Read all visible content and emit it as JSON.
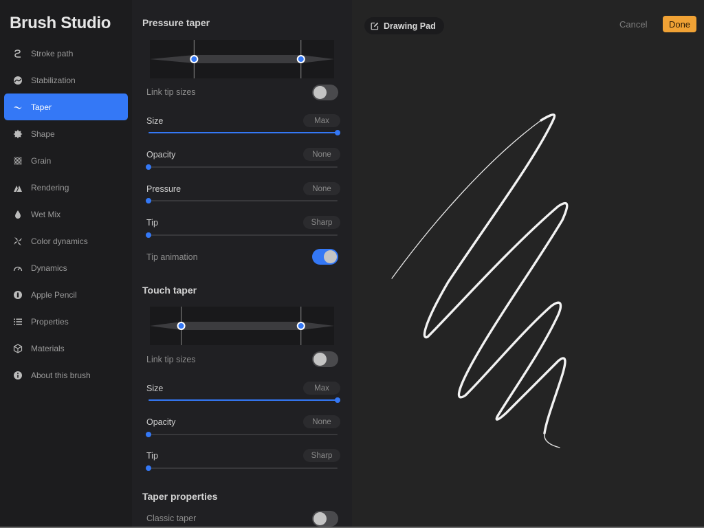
{
  "app": {
    "title": "Brush Studio"
  },
  "sidebar": {
    "items": [
      {
        "label": "Stroke path",
        "icon": "stroke-path-icon",
        "active": false
      },
      {
        "label": "Stabilization",
        "icon": "stabilization-icon",
        "active": false
      },
      {
        "label": "Taper",
        "icon": "taper-icon",
        "active": true
      },
      {
        "label": "Shape",
        "icon": "shape-icon",
        "active": false
      },
      {
        "label": "Grain",
        "icon": "grain-icon",
        "active": false
      },
      {
        "label": "Rendering",
        "icon": "rendering-icon",
        "active": false
      },
      {
        "label": "Wet Mix",
        "icon": "wet-mix-icon",
        "active": false
      },
      {
        "label": "Color dynamics",
        "icon": "color-dynamics-icon",
        "active": false
      },
      {
        "label": "Dynamics",
        "icon": "dynamics-icon",
        "active": false
      },
      {
        "label": "Apple Pencil",
        "icon": "apple-pencil-icon",
        "active": false
      },
      {
        "label": "Properties",
        "icon": "properties-icon",
        "active": false
      },
      {
        "label": "Materials",
        "icon": "materials-icon",
        "active": false
      },
      {
        "label": "About this brush",
        "icon": "info-icon",
        "active": false
      }
    ]
  },
  "pressure_taper": {
    "title": "Pressure taper",
    "taper_start": 0.24,
    "taper_end": 0.82,
    "link_tip_sizes": {
      "label": "Link tip sizes",
      "on": false
    },
    "size": {
      "label": "Size",
      "value_label": "Max",
      "value": 1.0
    },
    "opacity": {
      "label": "Opacity",
      "value_label": "None",
      "value": 0.0
    },
    "pressure": {
      "label": "Pressure",
      "value_label": "None",
      "value": 0.0
    },
    "tip": {
      "label": "Tip",
      "value_label": "Sharp",
      "value": 0.0
    },
    "tip_animation": {
      "label": "Tip animation",
      "on": true
    }
  },
  "touch_taper": {
    "title": "Touch taper",
    "taper_start": 0.17,
    "taper_end": 0.82,
    "link_tip_sizes": {
      "label": "Link tip sizes",
      "on": false
    },
    "size": {
      "label": "Size",
      "value_label": "Max",
      "value": 1.0
    },
    "opacity": {
      "label": "Opacity",
      "value_label": "None",
      "value": 0.0
    },
    "tip": {
      "label": "Tip",
      "value_label": "Sharp",
      "value": 0.0
    }
  },
  "taper_properties": {
    "title": "Taper properties",
    "classic_taper": {
      "label": "Classic taper",
      "on": false
    }
  },
  "drawing_pad": {
    "label": "Drawing Pad",
    "cancel_label": "Cancel",
    "done_label": "Done"
  },
  "colors": {
    "accent": "#3478f6",
    "done": "#f0a235"
  }
}
